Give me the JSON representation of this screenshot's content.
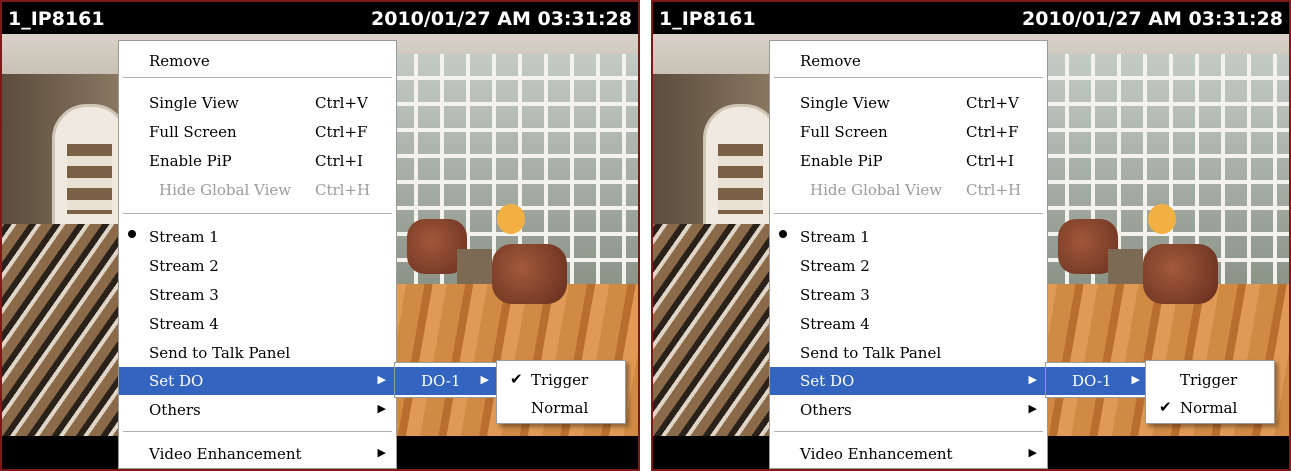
{
  "panels": [
    {
      "camera_name": "1_IP8161",
      "timestamp": "2010/01/27 AM 03:31:28",
      "menu": {
        "remove": "Remove",
        "single_view": "Single View",
        "single_view_shortcut": "Ctrl+V",
        "full_screen": "Full Screen",
        "full_screen_shortcut": "Ctrl+F",
        "enable_pip": "Enable PiP",
        "enable_pip_shortcut": "Ctrl+I",
        "hide_global_view": "Hide Global View",
        "hide_global_view_shortcut": "Ctrl+H",
        "stream1": "Stream 1",
        "stream2": "Stream 2",
        "stream3": "Stream 3",
        "stream4": "Stream 4",
        "send_to_talk": "Send to Talk Panel",
        "set_do": "Set DO",
        "others": "Others",
        "video_enhancement": "Video Enhancement"
      },
      "submenu": {
        "do1": "DO-1"
      },
      "submenu2": {
        "trigger": "Trigger",
        "normal": "Normal",
        "checked": "trigger"
      }
    },
    {
      "camera_name": "1_IP8161",
      "timestamp": "2010/01/27 AM 03:31:28",
      "menu": {
        "remove": "Remove",
        "single_view": "Single View",
        "single_view_shortcut": "Ctrl+V",
        "full_screen": "Full Screen",
        "full_screen_shortcut": "Ctrl+F",
        "enable_pip": "Enable PiP",
        "enable_pip_shortcut": "Ctrl+I",
        "hide_global_view": "Hide Global View",
        "hide_global_view_shortcut": "Ctrl+H",
        "stream1": "Stream 1",
        "stream2": "Stream 2",
        "stream3": "Stream 3",
        "stream4": "Stream 4",
        "send_to_talk": "Send to Talk Panel",
        "set_do": "Set DO",
        "others": "Others",
        "video_enhancement": "Video Enhancement"
      },
      "submenu": {
        "do1": "DO-1"
      },
      "submenu2": {
        "trigger": "Trigger",
        "normal": "Normal",
        "checked": "normal"
      }
    }
  ],
  "colors": {
    "frame": "#7b1a16",
    "selection": "#3264c0"
  }
}
